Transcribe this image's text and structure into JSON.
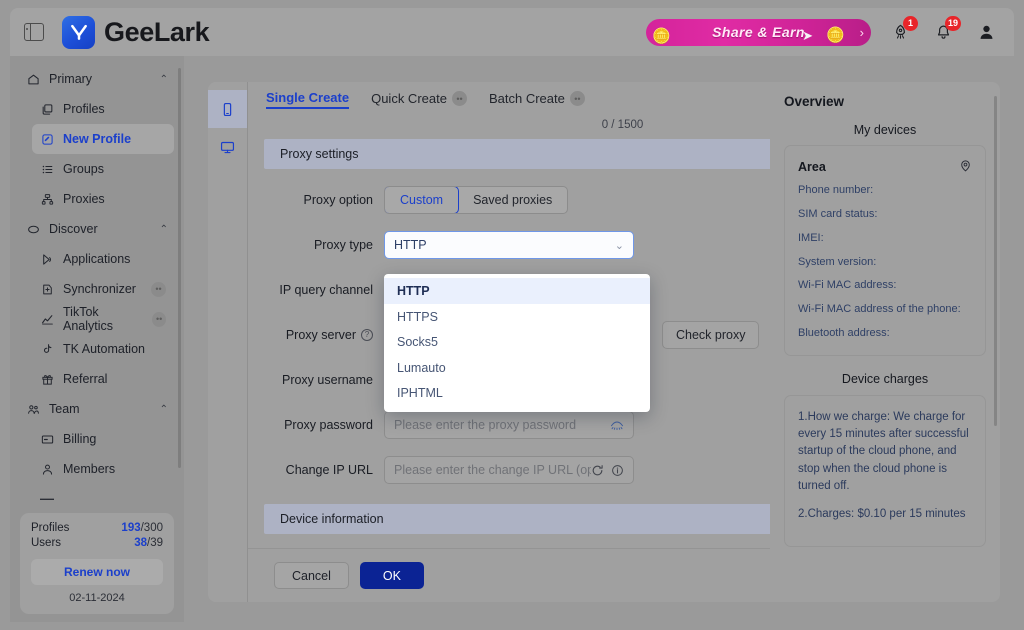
{
  "topbar": {
    "panel_toggle_icon": "panel-toggle-icon",
    "brand_name": "GeeLark",
    "brand_mark": "Y",
    "share_banner": {
      "text": "Share  &   Earn",
      "coin_left": "🪙",
      "coin_right": "🪙",
      "chevron": "›",
      "cursor": "➤"
    },
    "rocket_badge": "1",
    "bell_badge": "19"
  },
  "sidebar": {
    "groups": [
      {
        "label": "Primary",
        "icon": "home-icon",
        "chevron": "⌃",
        "items": [
          {
            "label": "Profiles",
            "icon": "profiles-icon",
            "active": false,
            "disabled": false
          },
          {
            "label": "New Profile",
            "icon": "new-profile-icon",
            "active": true,
            "disabled": false
          },
          {
            "label": "Groups",
            "icon": "groups-icon",
            "active": false,
            "disabled": false
          },
          {
            "label": "Proxies",
            "icon": "proxies-icon",
            "active": false,
            "disabled": false
          }
        ]
      },
      {
        "label": "Discover",
        "icon": "discover-icon",
        "chevron": "⌃",
        "items": [
          {
            "label": "Applications",
            "icon": "applications-icon",
            "active": false,
            "disabled": false
          },
          {
            "label": "Synchronizer",
            "icon": "synchronizer-icon",
            "active": false,
            "disabled": true
          },
          {
            "label": "TikTok Analytics",
            "icon": "analytics-icon",
            "active": false,
            "disabled": true
          },
          {
            "label": "TK Automation",
            "icon": "tiktok-icon",
            "active": false,
            "disabled": false
          },
          {
            "label": "Referral",
            "icon": "gift-icon",
            "active": false,
            "disabled": false
          }
        ]
      },
      {
        "label": "Team",
        "icon": "team-icon",
        "chevron": "⌃",
        "items": [
          {
            "label": "Billing",
            "icon": "billing-icon",
            "active": false,
            "disabled": false
          },
          {
            "label": "Members",
            "icon": "members-icon",
            "active": false,
            "disabled": false
          }
        ]
      }
    ],
    "collapse_dash": "—",
    "quota": {
      "profiles_label": "Profiles",
      "profiles_used": "193",
      "profiles_total": "/300",
      "users_label": "Users",
      "users_used": "38",
      "users_total": "/39",
      "renew_label": "Renew now",
      "date": "02-11-2024"
    }
  },
  "modal": {
    "rail": [
      {
        "icon": "phone-icon",
        "active": true
      },
      {
        "icon": "desktop-icon",
        "active": false
      }
    ],
    "tabs": [
      {
        "label": "Single Create",
        "active": true,
        "disabled": false
      },
      {
        "label": "Quick Create",
        "active": false,
        "disabled": true
      },
      {
        "label": "Batch Create",
        "active": false,
        "disabled": true
      }
    ],
    "counter": "0 / 1500",
    "sections": {
      "proxy_settings": {
        "title": "Proxy settings",
        "chevron": "⌃"
      },
      "device_information": {
        "title": "Device information",
        "chevron": "⌃"
      }
    },
    "fields": {
      "proxy_option": {
        "label": "Proxy option",
        "options": [
          "Custom",
          "Saved proxies"
        ],
        "selected": "Custom"
      },
      "proxy_type": {
        "label": "Proxy type",
        "value": "HTTP",
        "chevron": "⌄",
        "options": [
          "HTTP",
          "HTTPS",
          "Socks5",
          "Lumauto",
          "IPHTML"
        ],
        "selected": "HTTP"
      },
      "ip_query_channel": {
        "label": "IP query channel"
      },
      "proxy_server": {
        "label": "Proxy server",
        "help": "?"
      },
      "check_proxy_label": "Check proxy",
      "proxy_username": {
        "label": "Proxy username"
      },
      "proxy_password": {
        "label": "Proxy password",
        "placeholder": "Please enter the proxy password",
        "value": "",
        "eye_icon": "eye-off-icon"
      },
      "change_ip_url": {
        "label": "Change IP URL",
        "placeholder": "Please enter the change IP URL (option...",
        "value": "",
        "refresh_icon": "refresh-icon",
        "info_icon": "info-icon"
      }
    },
    "footer": {
      "cancel_label": "Cancel",
      "ok_label": "OK"
    }
  },
  "overview": {
    "title": "Overview",
    "devices_title": "My devices",
    "area_label": "Area",
    "area_icon": "location-pin-icon",
    "device_fields": [
      "Phone number:",
      "SIM card status:",
      "IMEI:",
      "System version:",
      "Wi-Fi MAC address:",
      "Wi-Fi MAC address of the phone:",
      "Bluetooth address:"
    ],
    "charges_title": "Device charges",
    "charges_paragraphs": [
      "1.How we charge: We charge for every 15 minutes after successful startup of the cloud phone, and stop when the cloud phone is turned off.",
      "2.Charges: $0.10 per 15 minutes"
    ]
  },
  "colors": {
    "accent": "#1b3fcb",
    "primary_button": "#0b2394",
    "badge_red": "#e8252a",
    "banner_pink": "#d4249b"
  }
}
